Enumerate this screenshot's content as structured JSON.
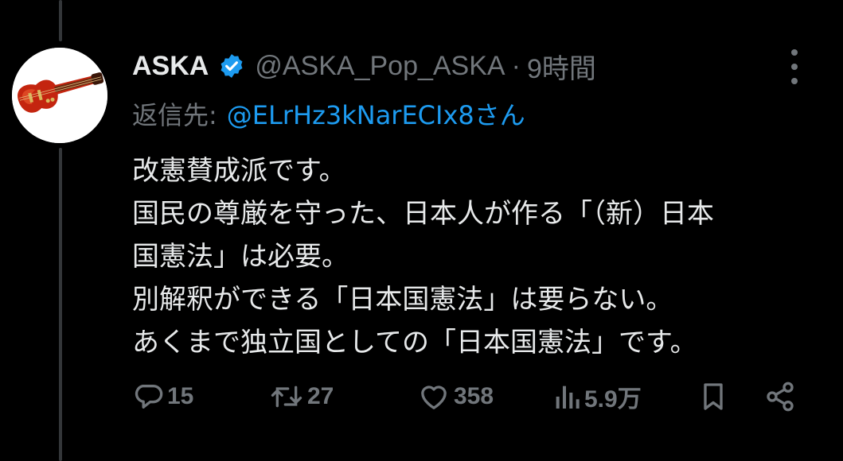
{
  "tweet": {
    "author_name": "ASKA",
    "author_handle": "@ASKA_Pop_ASKA",
    "separator": "·",
    "time": "9時間",
    "reply_label": "返信先:",
    "reply_user": "@ELrHz3kNarECIx8さん",
    "body_lines": [
      "改憲賛成派です。",
      "国民の尊厳を守った、日本人が作る「（新）日本",
      "国憲法」は必要。",
      "別解釈ができる「日本国憲法」は要らない。",
      "あくまで独立国としての「日本国憲法」です。"
    ]
  },
  "actions": {
    "replies": "15",
    "reposts": "27",
    "likes": "358",
    "views": "5.9万"
  },
  "icons": {
    "avatar": "guitar-avatar",
    "verified": "verified-badge-icon",
    "more": "more-dots-icon",
    "reply": "reply-icon",
    "repost": "repost-icon",
    "like": "heart-icon",
    "views": "views-icon",
    "bookmark": "bookmark-icon",
    "share": "share-icon"
  },
  "colors": {
    "background": "#000000",
    "text": "#e7e9ea",
    "muted": "#71767b",
    "accent": "#1d9bf0"
  }
}
